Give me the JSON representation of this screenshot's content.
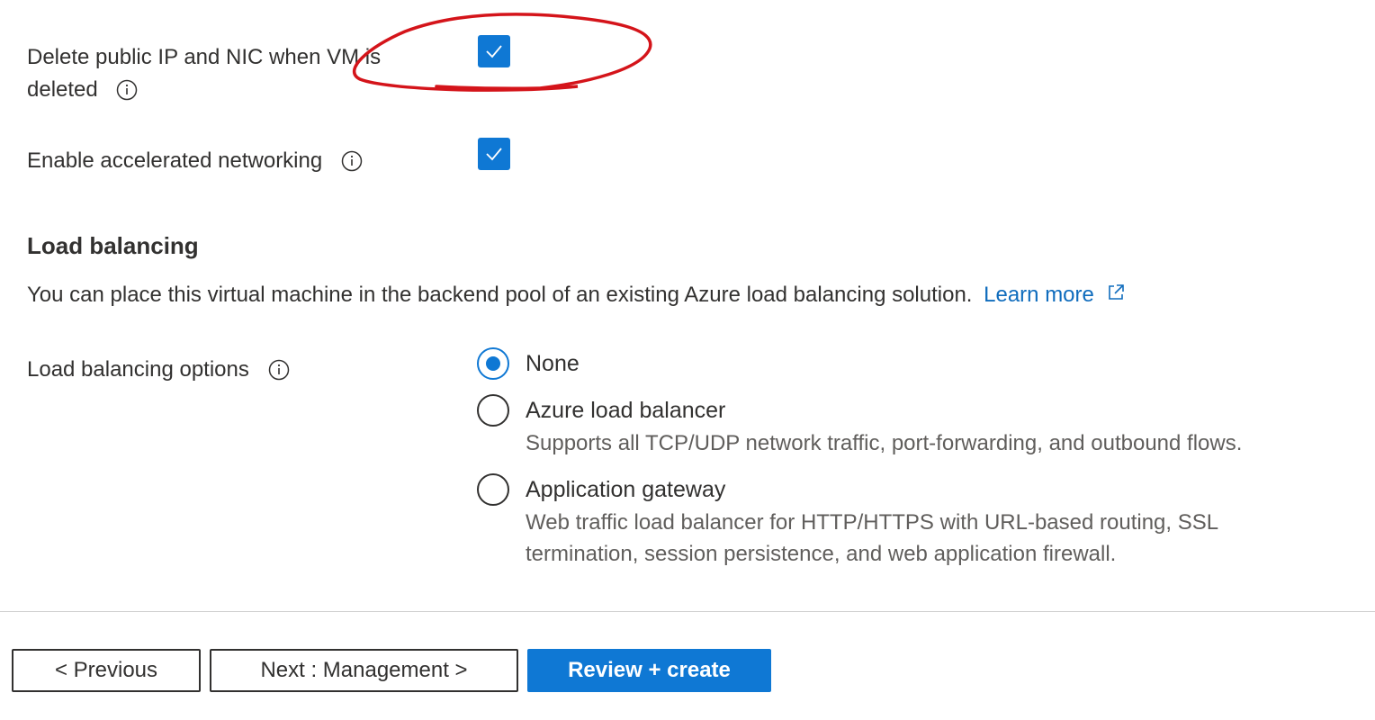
{
  "rows": {
    "delete_ip": {
      "label_line1": "Delete public IP and NIC when VM is",
      "label_line2": "deleted",
      "checked": true
    },
    "accel_net": {
      "label": "Enable accelerated networking",
      "checked": true
    }
  },
  "load_balancing": {
    "title": "Load balancing",
    "description": "You can place this virtual machine in the backend pool of an existing Azure load balancing solution.",
    "learn_more": "Learn more",
    "options_label": "Load balancing options",
    "selected": "None",
    "options": [
      {
        "label": "None",
        "desc": []
      },
      {
        "label": "Azure load balancer",
        "desc": [
          "Supports all TCP/UDP network traffic, port-forwarding, and outbound flows."
        ]
      },
      {
        "label": "Application gateway",
        "desc": [
          "Web traffic load balancer for HTTP/HTTPS with URL-based routing, SSL",
          "termination, session persistence, and web application firewall."
        ]
      }
    ]
  },
  "footer": {
    "previous": "< Previous",
    "next": "Next : Management >",
    "review": "Review + create"
  },
  "colors": {
    "accent": "#0f78d4",
    "annotation": "#d4141a",
    "link": "#0f6cbd"
  },
  "icons": [
    "info-icon",
    "checkmark-icon",
    "external-link-icon"
  ]
}
